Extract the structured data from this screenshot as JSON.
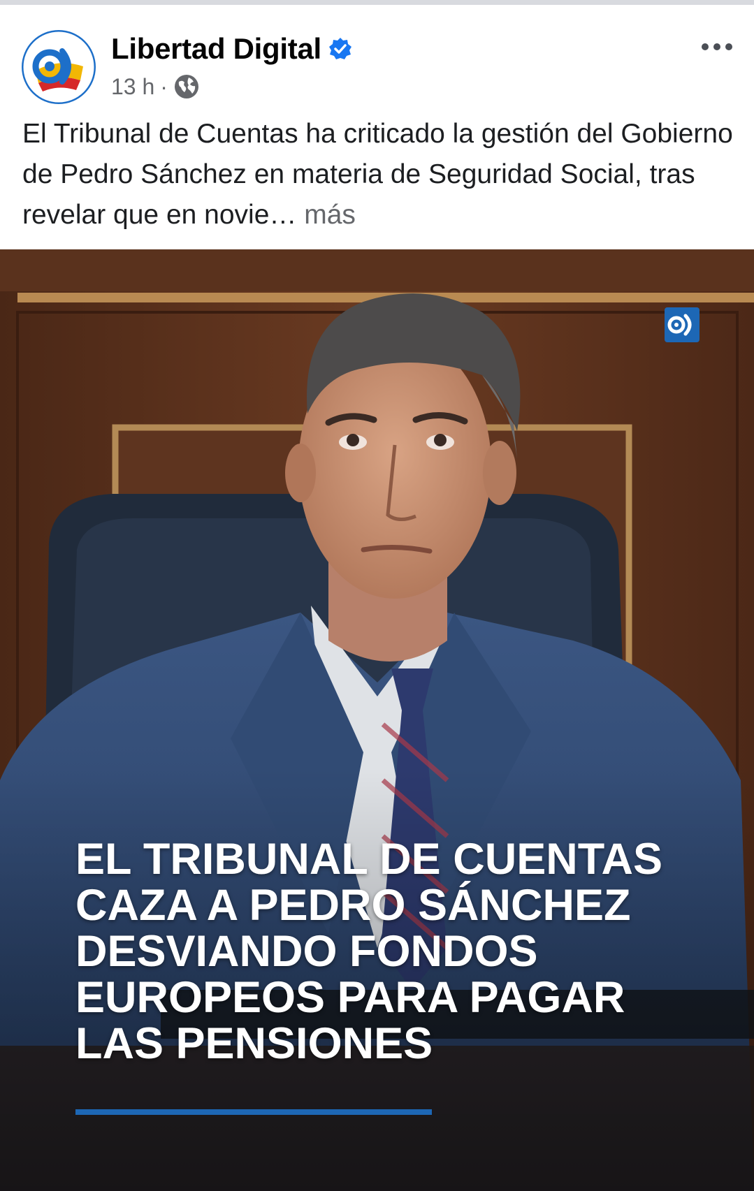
{
  "post": {
    "page_name": "Libertad Digital",
    "time": "13 h",
    "separator": "·",
    "text": "El Tribunal de Cuentas ha criticado la gestión del Gobierno de Pedro Sánchez en materia de Seguridad Social, tras revelar que en novie…",
    "see_more": "más",
    "icons": {
      "avatar": "libertad-digital-logo",
      "verified": "verified-badge-icon",
      "audience": "globe-icon",
      "menu": "more-options-icon"
    }
  },
  "image": {
    "headline_lines": [
      "EL TRIBUNAL DE CUENTAS",
      "CAZA A PEDRO SÁNCHEZ",
      "DESVIANDO FONDOS",
      "EUROPEOS PARA PAGAR",
      "LAS PENSIONES"
    ],
    "accent_color": "#1d67b5"
  },
  "colors": {
    "brand_blue": "#1877f2",
    "muted_text": "#65676b",
    "body_text": "#1c1e21"
  }
}
